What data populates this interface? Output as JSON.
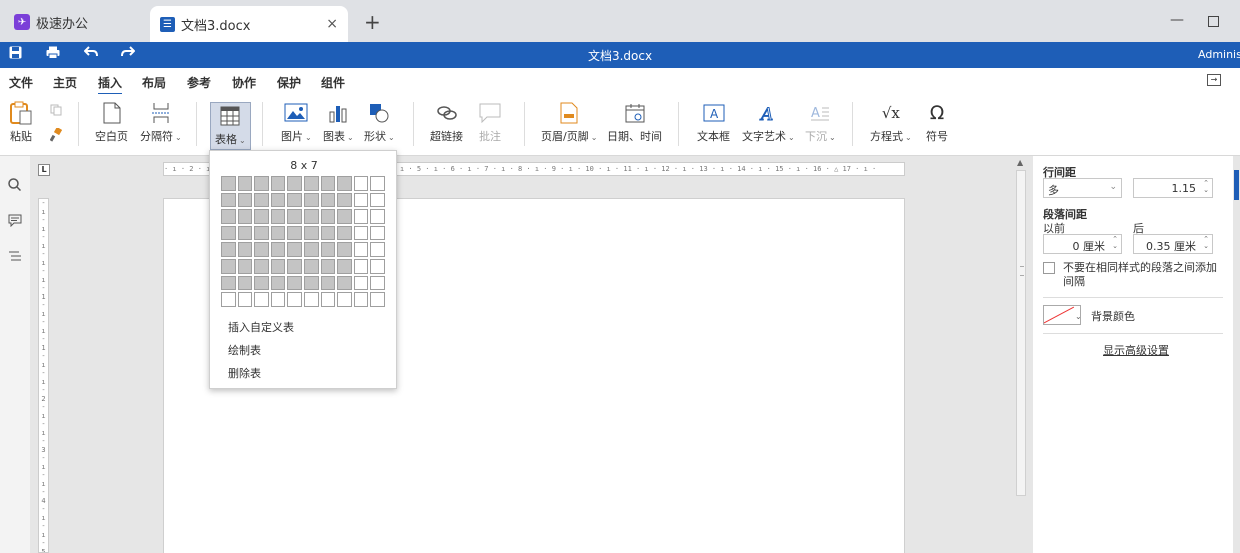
{
  "window": {
    "app_tab_label": "极速办公",
    "doc_tab_label": "文档3.docx",
    "new_tab": "+",
    "close_tab": "×",
    "minimize": "—"
  },
  "command_bar": {
    "title": "文档3.docx",
    "user": "Administ"
  },
  "menu": {
    "items": [
      "文件",
      "主页",
      "插入",
      "布局",
      "参考",
      "协作",
      "保护",
      "组件"
    ],
    "active": "插入"
  },
  "ribbon": {
    "paste": "粘贴",
    "blank_page": "空白页",
    "separator": "分隔符",
    "table": "表格",
    "picture": "图片",
    "chart": "图表",
    "shape": "形状",
    "hyperlink": "超链接",
    "comment": "批注",
    "header_footer": "页眉/页脚",
    "date_time": "日期、时间",
    "text_box": "文本框",
    "text_art": "文字艺术",
    "drop_cap": "下沉",
    "equation": "方程式",
    "symbol": "符号",
    "equation_glyph": "√x",
    "symbol_glyph": "Ω"
  },
  "ruler": {
    "corner": "L",
    "horizontal": "· ı · 2 · ı · 1 · ı ·   · ı · 1 · ı · 2 · ı · 3 · ı · 4 · ı · 5 · ı · 6 · ı · 7 · ı · 8 · ı · 9 · ı · 10 · ı · 11 · ı · 12 · ı · 13 · ı · 14 · ı · 15 · ı · 16 · △ 17 · ı ·"
  },
  "table_dropdown": {
    "size_label": "8 x 7",
    "rows": 8,
    "cols": 10,
    "selected_rows": 7,
    "selected_cols": 8,
    "items": [
      "插入自定义表",
      "绘制表",
      "删除表"
    ]
  },
  "right_panel": {
    "line_spacing_label": "行间距",
    "line_spacing_mode": "多",
    "line_spacing_value": "1.15",
    "paragraph_spacing_label": "段落间距",
    "before_label": "以前",
    "after_label": "后",
    "before_value": "0 厘米",
    "after_value": "0.35 厘米",
    "no_space_same_style": "不要在相同样式的段落之间添加间隔",
    "background_color_label": "背景颜色",
    "show_advanced": "显示高级设置"
  },
  "colors": {
    "brand_blue": "#1e5eb7",
    "app_logo": "#7b3fd8",
    "grid_selected": "#c4c4c4"
  }
}
